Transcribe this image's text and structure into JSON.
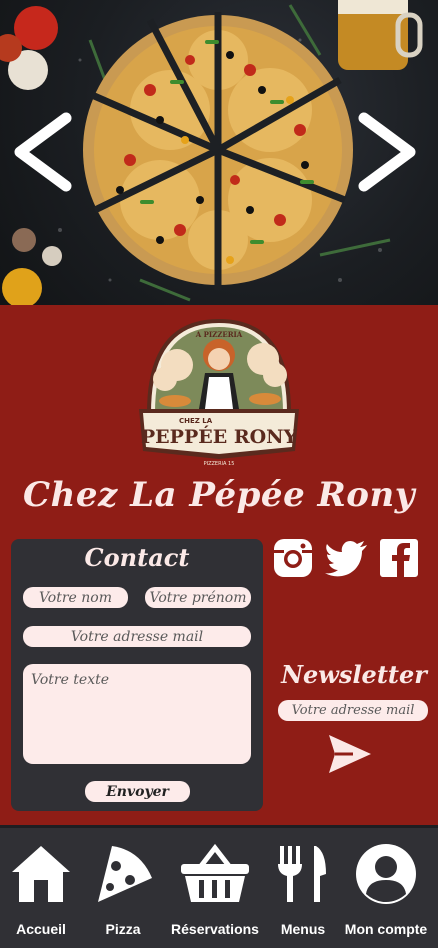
{
  "carousel": {
    "prev_icon": "chevron-left-icon",
    "next_icon": "chevron-right-icon"
  },
  "logo": {
    "arc_text": "A PIZZERIA",
    "small_text": "CHEZ LA",
    "main_text": "PEPPÉE RONY",
    "bottom_text": "PIZZERIA 15"
  },
  "brand": {
    "title": "Chez La Pépée Rony"
  },
  "contact": {
    "title": "Contact",
    "name_placeholder": "Votre nom",
    "firstname_placeholder": "Votre prénom",
    "email_placeholder": "Votre adresse mail",
    "text_placeholder": "Votre texte",
    "submit_label": "Envoyer"
  },
  "social": {
    "items": [
      {
        "icon": "instagram-icon"
      },
      {
        "icon": "twitter-icon"
      },
      {
        "icon": "facebook-icon"
      }
    ]
  },
  "newsletter": {
    "title": "Newsletter",
    "email_placeholder": "Votre adresse mail",
    "send_icon": "send-icon"
  },
  "nav": {
    "items": [
      {
        "label": "Accueil",
        "icon": "home-icon"
      },
      {
        "label": "Pizza",
        "icon": "pizza-icon"
      },
      {
        "label": "Réservations",
        "icon": "basket-icon"
      },
      {
        "label": "Menus",
        "icon": "utensils-icon"
      },
      {
        "label": "Mon compte",
        "icon": "user-icon"
      }
    ]
  },
  "colors": {
    "primary_red": "#8f1d16",
    "dark": "#303035",
    "light_pink": "#fdebea",
    "text_light": "#fbe9e7"
  }
}
